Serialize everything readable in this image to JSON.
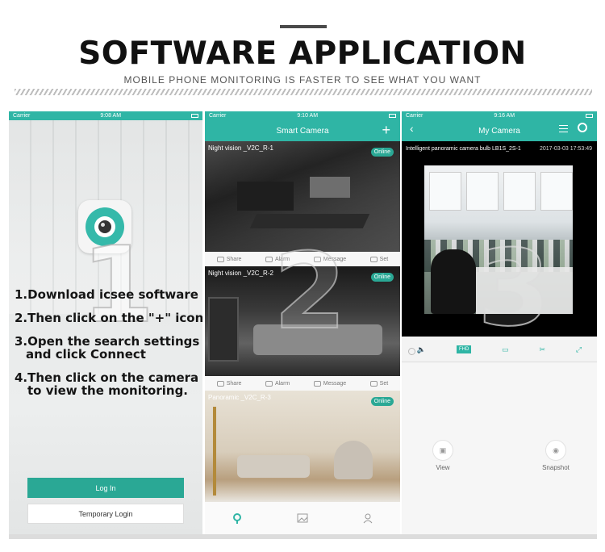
{
  "header": {
    "title": "SOFTWARE APPLICATION",
    "subtitle": "MOBILE PHONE MONITORING IS FASTER TO SEE WHAT YOU WANT"
  },
  "phone1": {
    "status": {
      "carrier": "Carrier",
      "time": "9:08 AM"
    },
    "big_number": "1",
    "steps": [
      "1.Download icsee software",
      "2.Then click on the \"+\" icon",
      "3.Open the search settings",
      "and click Connect",
      "4.Then click on the camera",
      "to view the monitoring."
    ],
    "login_label": "Log In",
    "temporary_login_label": "Temporary Login",
    "accent_color": "#2fb5a5"
  },
  "phone2": {
    "status": {
      "carrier": "Carrier",
      "time": "9:10 AM"
    },
    "title": "Smart Camera",
    "plus": "+",
    "big_number": "2",
    "cameras": [
      {
        "name": "Night vision _V2C_R-1",
        "status": "Online"
      },
      {
        "name": "Night vision _V2C_R-2",
        "status": "Online"
      },
      {
        "name": "Panoramic _V2C_R-3",
        "status": "Online"
      }
    ],
    "actions": [
      "Share",
      "Alarm",
      "Message",
      "Set"
    ],
    "tabs": [
      "camera-tab",
      "gallery-tab",
      "profile-tab"
    ]
  },
  "phone3": {
    "status": {
      "carrier": "Carrier",
      "time": "9:16 AM"
    },
    "title": "My Camera",
    "back": "‹",
    "video_title": "Intelligent panoramic camera bulb LB1S_2S-1",
    "video_time": "2017-03-03 17:53:49",
    "big_number": "3",
    "controls": [
      "🔈",
      "FHD",
      "▭",
      "✂",
      "⤢"
    ],
    "view_label": "View",
    "snapshot_label": "Snapshot"
  }
}
